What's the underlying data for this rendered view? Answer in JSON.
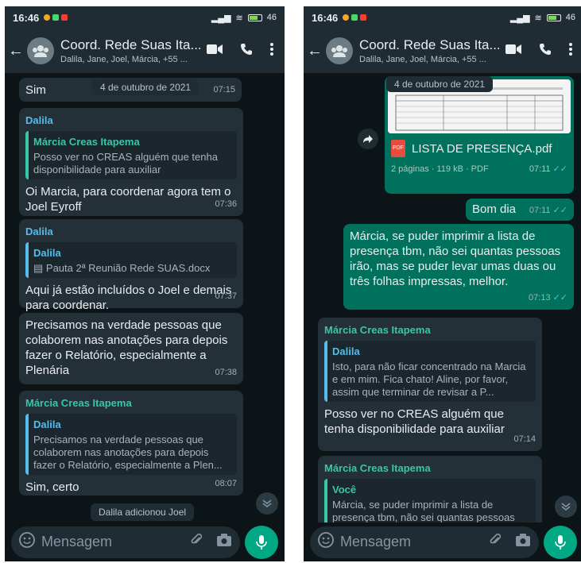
{
  "status_bar": {
    "time": "16:46",
    "battery": "46"
  },
  "chat": {
    "title": "Coord. Rede Suas Ita...",
    "participants": "Dalila, Jane, Joel, Márcia, +55 ...",
    "composer_placeholder": "Mensagem"
  },
  "left": {
    "msg1": {
      "text": "Sim",
      "time": "07:15"
    },
    "date_separator": "4 de outubro de 2021",
    "msg2": {
      "sender": "Dalila",
      "quote_name": "Márcia Creas Itapema",
      "quote_text": "Posso ver no CREAS alguém que tenha disponibilidade para auxiliar",
      "text": "Oi Marcia,  para coordenar agora tem o Joel Eyroff",
      "time": "07:36"
    },
    "msg3": {
      "sender": "Dalila",
      "quote_name": "Dalila",
      "quote_text": "Pauta 2ª Reunião Rede SUAS.docx",
      "text": "Aqui já estão incluídos o Joel e demais para coordenar.",
      "time": "07:37"
    },
    "msg4": {
      "text": "Precisamos na verdade pessoas que colaborem nas anotações para depois fazer o Relatório, especialmente a Plenária",
      "time": "07:38"
    },
    "msg5": {
      "sender": "Márcia Creas Itapema",
      "quote_name": "Dalila",
      "quote_text": "Precisamos na verdade pessoas que colaborem nas anotações para depois fazer o Relatório,  especialmente a Plen...",
      "text": "Sim, certo",
      "time": "08:07"
    },
    "system": "Dalila adicionou Joel"
  },
  "right": {
    "date_separator": "4 de outubro de 2021",
    "pdf": {
      "filename": "LISTA DE PRESENÇA.pdf",
      "meta": "2 páginas · 119 kB · PDF",
      "time": "07:11"
    },
    "msg_bomdia": {
      "text": "Bom dia",
      "time": "07:11"
    },
    "msg_long": {
      "text": "Márcia, se puder imprimir a lista de presença tbm, não sei quantas pessoas irão, mas se puder levar umas duas ou três folhas impressas, melhor.",
      "time": "07:13"
    },
    "msg_reply1": {
      "sender": "Márcia Creas Itapema",
      "quote_name": "Dalila",
      "quote_text": "Isto, para não ficar concentrado na Marcia e em mim. Fica chato!  Aline, por favor, assim que terminar de revisar a P...",
      "text": "Posso ver no CREAS alguém que tenha disponibilidade para auxiliar",
      "time": "07:14"
    },
    "msg_reply2": {
      "sender": "Márcia Creas Itapema",
      "quote_name": "Você",
      "quote_text": "Márcia, se puder imprimir a lista de presença tbm, não sei quantas pessoas irão, mas se puder levar umas duas ou..."
    }
  },
  "colors": {
    "background": "#0d1418",
    "header": "#1f2c33",
    "incoming_bubble": "#243038",
    "outgoing_bubble": "#00715d",
    "accent": "#00a884",
    "sender_teal": "#38c6a8",
    "sender_blue": "#53bdeb"
  },
  "icons": [
    "back-arrow-icon",
    "group-avatar-icon",
    "video-call-icon",
    "phone-call-icon",
    "more-options-icon",
    "emoji-icon",
    "attach-icon",
    "camera-icon",
    "mic-icon",
    "scroll-down-icon",
    "share-icon",
    "pdf-icon",
    "double-check-icon"
  ]
}
